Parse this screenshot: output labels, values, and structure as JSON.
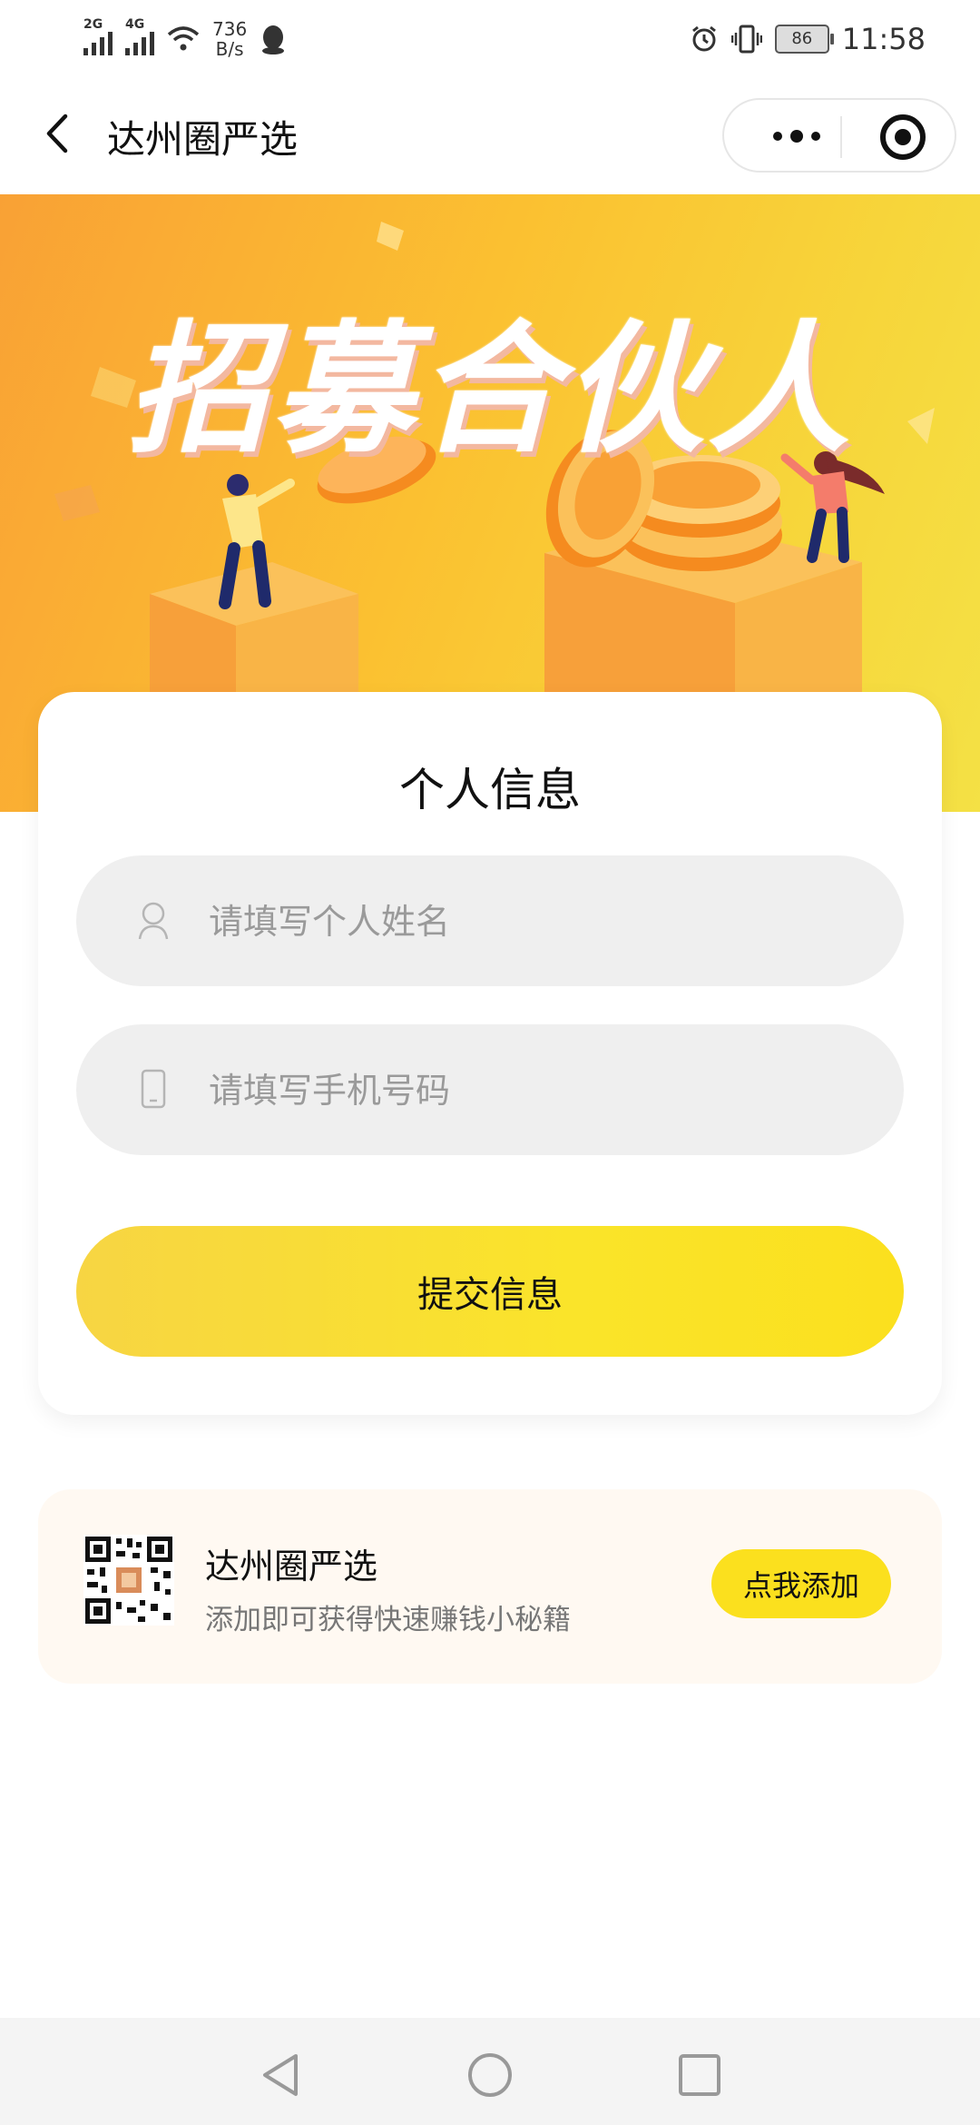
{
  "status_bar": {
    "signal1_label": "2G",
    "signal2_label": "4G",
    "net_speed_value": "736",
    "net_speed_unit": "B/s",
    "battery": "86",
    "time": "11:58"
  },
  "nav": {
    "title": "达州圈严选"
  },
  "banner": {
    "title": "招募合伙人"
  },
  "form": {
    "title": "个人信息",
    "name_placeholder": "请填写个人姓名",
    "phone_placeholder": "请填写手机号码",
    "submit_label": "提交信息"
  },
  "add_card": {
    "name": "达州圈严选",
    "description": "添加即可获得快速赚钱小秘籍",
    "button_label": "点我添加"
  },
  "icons": {
    "back": "back-arrow-icon",
    "more": "more-dots-icon",
    "close_target": "target-icon",
    "user": "user-icon",
    "phone": "phone-icon",
    "qr": "qr-code-icon"
  },
  "colors": {
    "accent_yellow": "#fbe01e",
    "banner_orange": "#f9a135",
    "field_bg": "#efefef"
  }
}
